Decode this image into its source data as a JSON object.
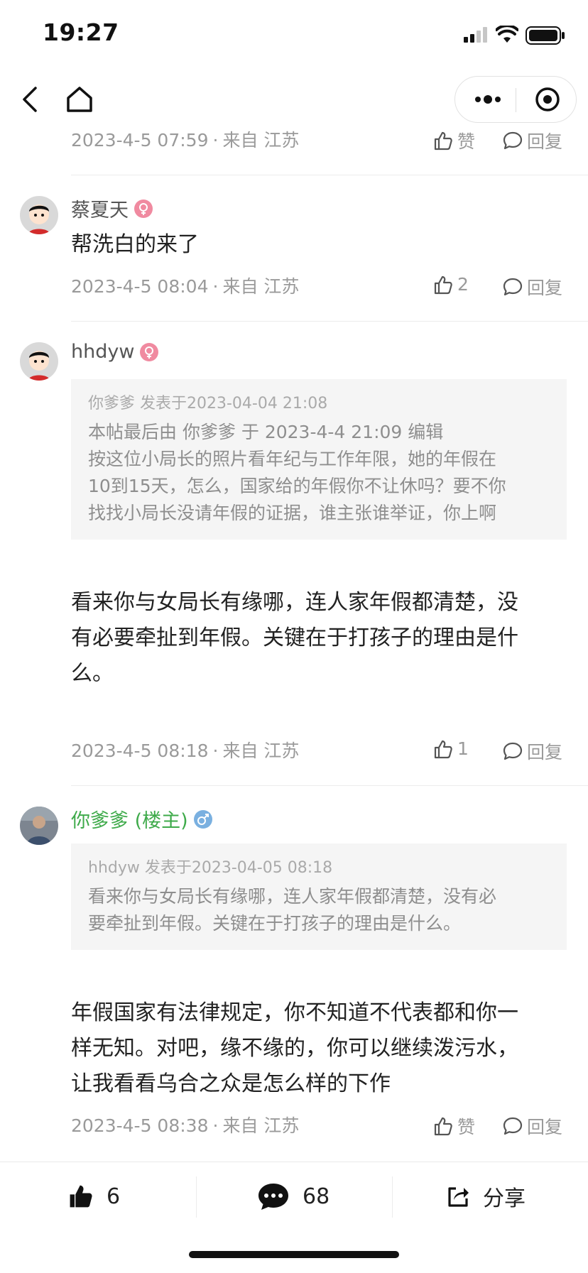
{
  "status_bar": {
    "time": "19:27"
  },
  "nav": {
    "back_icon": "chevron-left-icon",
    "home_icon": "home-icon",
    "more_icon": "more-dots-icon",
    "target_icon": "record-target-icon"
  },
  "comments": [
    {
      "meta": {
        "date": "2023-4-5 07:59",
        "dot": "·",
        "from": "来自",
        "region": "江苏"
      },
      "like_label": "赞",
      "reply_label": "回复"
    },
    {
      "user": {
        "name": "蔡夏天",
        "gender_icon": "female-icon"
      },
      "content": "帮洗白的来了",
      "meta": {
        "date": "2023-4-5 08:04",
        "dot": "·",
        "from": "来自",
        "region": "江苏"
      },
      "like_label": "2",
      "reply_label": "回复"
    },
    {
      "user": {
        "name": "hhdyw",
        "gender_icon": "female-icon"
      },
      "quote": {
        "header": "你爹爹 发表于2023-04-04 21:08",
        "lines": [
          "本帖最后由 你爹爹 于 2023-4-4 21:09 编辑",
          "按这位小局长的照片看年纪与工作年限，她的年假在",
          "10到15天，怎么，国家给的年假你不让休吗？要不你",
          "找找小局长没请年假的证据，谁主张谁举证，你上啊"
        ]
      },
      "content_lines": [
        "看来你与女局长有缘哪，连人家年假都清楚，没",
        "有必要牵扯到年假。关键在于打孩子的理由是什",
        "么。"
      ],
      "meta": {
        "date": "2023-4-5 08:18",
        "dot": "·",
        "from": "来自",
        "region": "江苏"
      },
      "like_label": "1",
      "reply_label": "回复"
    },
    {
      "user": {
        "name": "你爹爹 (楼主)",
        "gender_icon": "male-icon"
      },
      "quote": {
        "header": "hhdyw 发表于2023-04-05 08:18",
        "lines": [
          "看来你与女局长有缘哪，连人家年假都清楚，没有必",
          "要牵扯到年假。关键在于打孩子的理由是什么。"
        ]
      },
      "content_lines": [
        "年假国家有法律规定，你不知道不代表都和你一",
        "样无知。对吧，缘不缘的，你可以继续泼污水，",
        "让我看看乌合之众是怎么样的下作"
      ],
      "meta": {
        "date": "2023-4-5 08:38",
        "dot": "·",
        "from": "来自",
        "region": "江苏"
      },
      "like_label": "赞",
      "reply_label": "回复"
    }
  ],
  "bottom_bar": {
    "like_count": "6",
    "comment_count": "68",
    "share_label": "分享"
  },
  "colors": {
    "op_name": "#3eaa4a",
    "female_badge": "#f08aa0",
    "male_badge": "#7ab0e0",
    "meta_text": "#9a9a9a"
  }
}
